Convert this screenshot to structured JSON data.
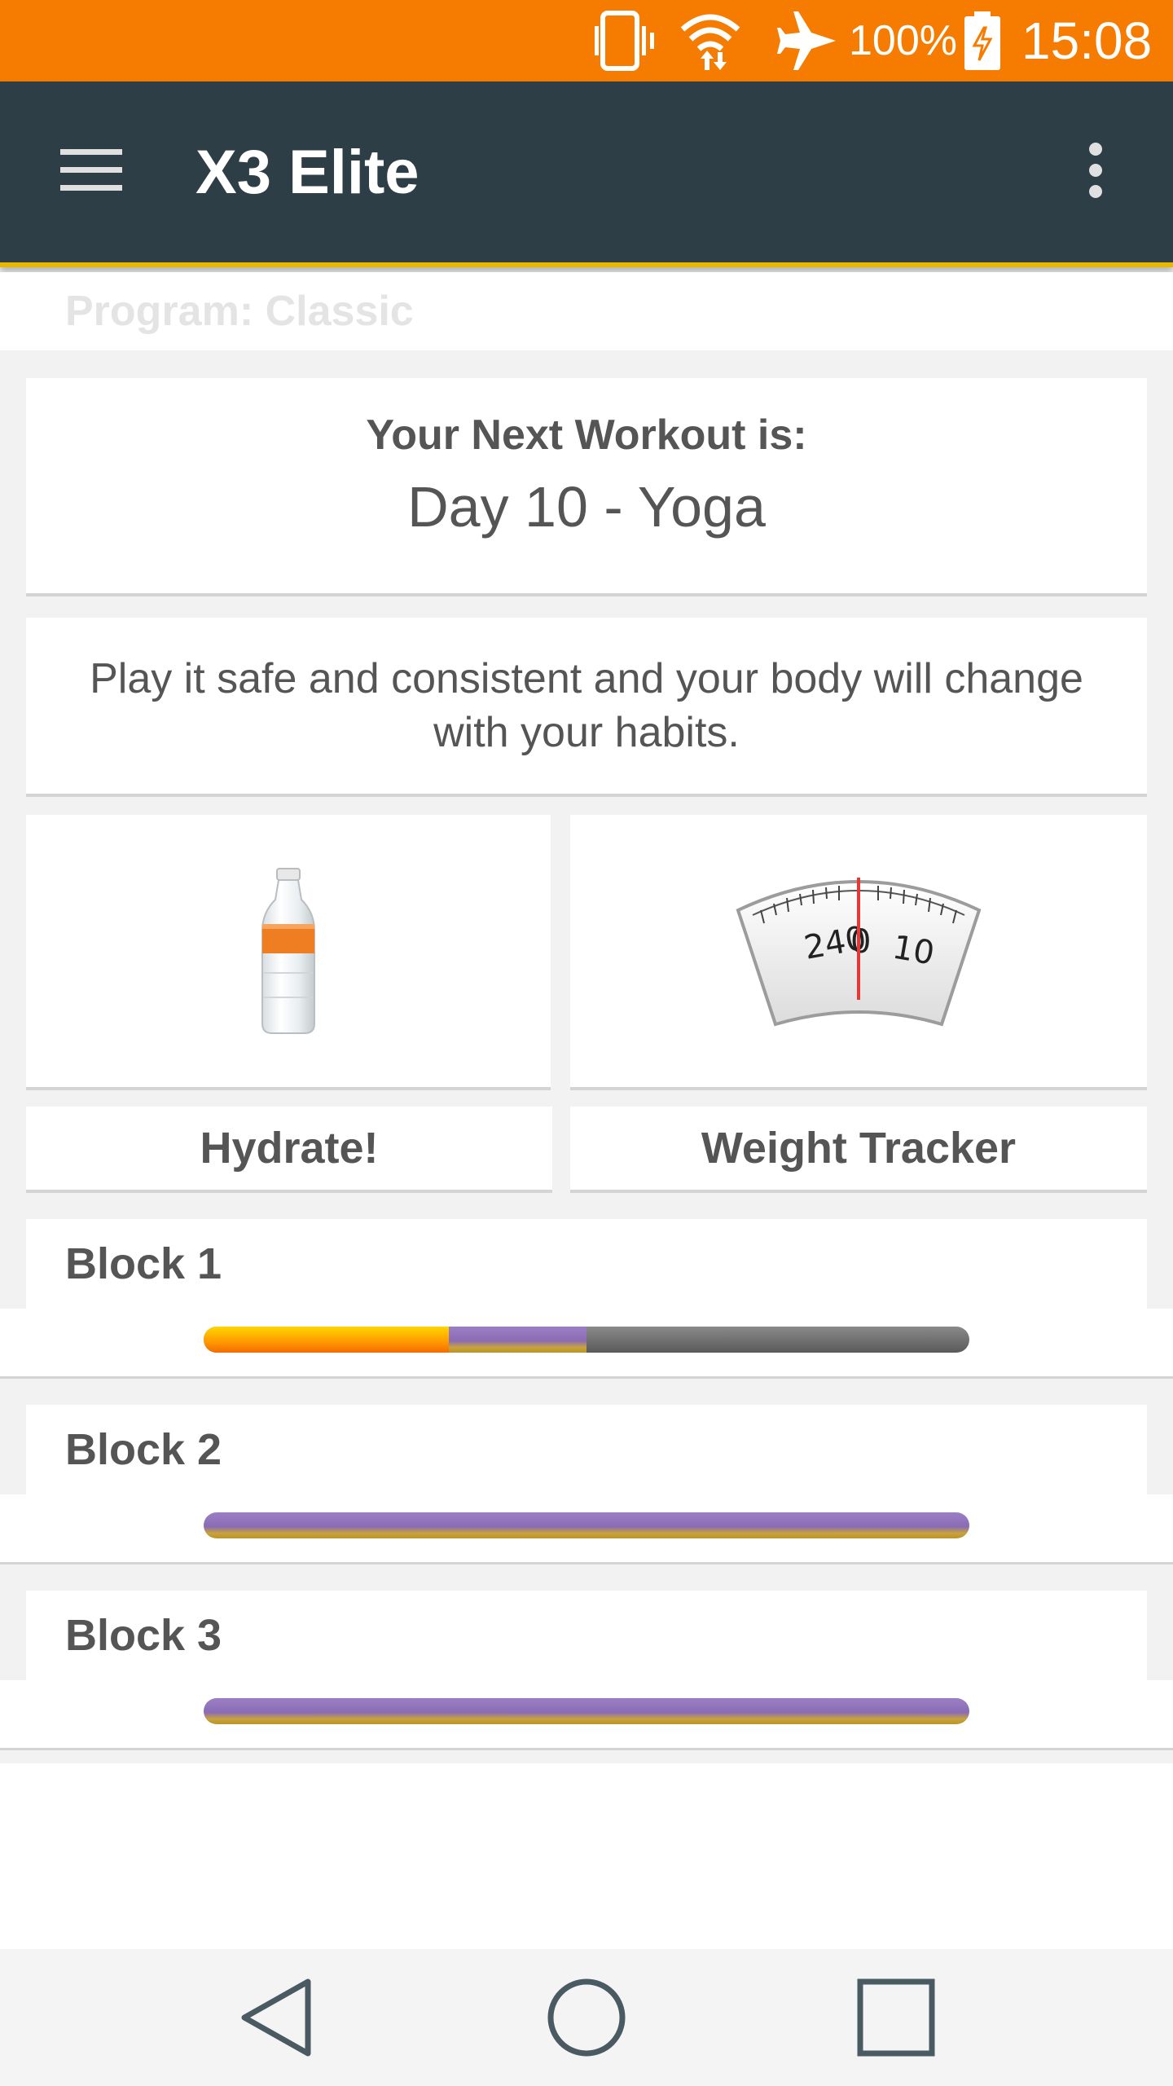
{
  "status_bar": {
    "battery_pct": "100%",
    "time": "15:08",
    "icons": [
      "vibrate-icon",
      "wifi-icon",
      "airplane-icon",
      "battery-icon"
    ]
  },
  "app_bar": {
    "title": "X3 Elite",
    "menu_icon": "hamburger-menu-icon",
    "overflow_icon": "more-vert-icon"
  },
  "program": {
    "label": "Program: Classic"
  },
  "next_workout": {
    "heading": "Your Next Workout is:",
    "value": "Day 10 - Yoga"
  },
  "tip": {
    "text": "Play it safe and consistent and your body will change with your habits."
  },
  "tiles": [
    {
      "label": "Hydrate!",
      "icon": "water-bottle-icon"
    },
    {
      "label": "Weight Tracker",
      "icon": "scale-icon",
      "scale_numbers": [
        "240",
        "0",
        "10"
      ]
    }
  ],
  "blocks": [
    {
      "title": "Block 1",
      "progress": {
        "done": 0.32,
        "current": 0.18
      }
    },
    {
      "title": "Block 2",
      "progress": {
        "done": 0,
        "current": 1.0
      }
    },
    {
      "title": "Block 3",
      "progress": {
        "done": 0,
        "current": 1.0
      }
    }
  ],
  "nav_bar": {
    "buttons": [
      "back-icon",
      "home-icon",
      "recents-icon"
    ]
  },
  "colors": {
    "status_bar": "#f57c00",
    "app_bar": "#2e3e46",
    "accent": "#e8b800",
    "progress_done": "#ff9800",
    "progress_current": "#8a6cb5"
  }
}
